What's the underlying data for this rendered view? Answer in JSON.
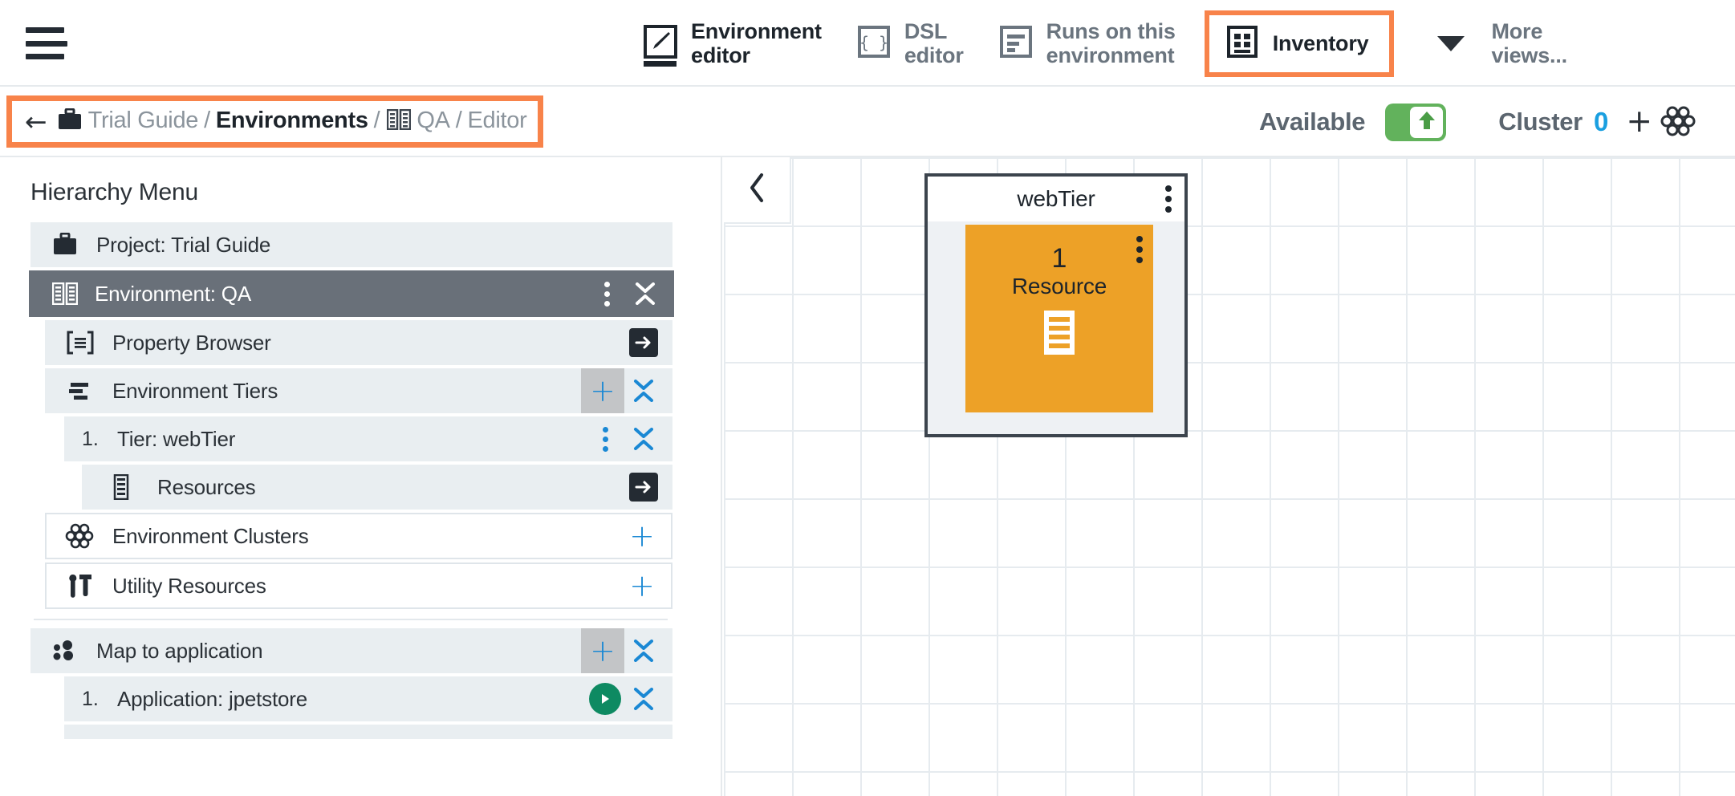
{
  "topbar": {
    "menu_icon": "hamburger-menu-icon",
    "tabs": [
      {
        "label": "Environment\neditor",
        "icon": "environment-editor-icon",
        "active": true,
        "highlighted": false
      },
      {
        "label": "DSL\neditor",
        "icon": "dsl-editor-icon",
        "active": false,
        "highlighted": false
      },
      {
        "label": "Runs on this\nenvironment",
        "icon": "runs-on-environment-icon",
        "active": false,
        "highlighted": false
      },
      {
        "label": "Inventory",
        "icon": "inventory-icon",
        "active": false,
        "highlighted": true
      },
      {
        "label": "More\nviews...",
        "icon": "chevron-down-icon",
        "active": false,
        "highlighted": false
      }
    ]
  },
  "breadcrumb": {
    "back_icon": "back-arrow-icon",
    "project_icon": "briefcase-icon",
    "project": "Trial Guide",
    "sep": "/",
    "section": "Environments",
    "env_icon": "environment-icon",
    "environment": "QA",
    "page": "Editor",
    "highlight_color": "#f8834a"
  },
  "status": {
    "availability_label": "Available",
    "toggle_on": true,
    "toggle_color": "#62b25c",
    "toggle_icon": "arrow-up-icon",
    "cluster_label": "Cluster",
    "cluster_count": "0",
    "cluster_count_color": "#1a9fe0",
    "add_cluster_label": "+",
    "cluster_icon": "cluster-icon"
  },
  "sidebar": {
    "title": "Hierarchy Menu",
    "rows": [
      {
        "level": "lvl0",
        "icon": "briefcase-icon",
        "label": "Project: Trial Guide",
        "num": "",
        "actions": []
      },
      {
        "level": "sel",
        "icon": "environment-icon",
        "label": "Environment: QA",
        "num": "",
        "actions": [
          "kebab-white",
          "collapse-white"
        ]
      },
      {
        "level": "lvl1",
        "icon": "property-browser-icon",
        "label": "Property Browser",
        "num": "",
        "actions": [
          "open-arrow"
        ]
      },
      {
        "level": "lvl1",
        "icon": "tiers-icon",
        "label": "Environment Tiers",
        "num": "",
        "actions": [
          "plus-highlighted",
          "collapse-blue"
        ]
      },
      {
        "level": "lvl2",
        "icon": "",
        "label": "Tier: webTier",
        "num": "1.",
        "actions": [
          "kebab-blue",
          "collapse-blue"
        ]
      },
      {
        "level": "lvl3",
        "icon": "resources-icon",
        "label": "Resources",
        "num": "",
        "actions": [
          "open-arrow"
        ]
      },
      {
        "level": "boxed-white",
        "icon": "cluster-icon",
        "label": "Environment Clusters",
        "num": "",
        "actions": [
          "plus-blue"
        ]
      },
      {
        "level": "boxed-white",
        "icon": "utility-icon",
        "label": "Utility Resources",
        "num": "",
        "actions": [
          "plus-blue"
        ]
      },
      {
        "level": "divider",
        "icon": "",
        "label": "",
        "num": "",
        "actions": []
      },
      {
        "level": "lvl0",
        "icon": "map-application-icon",
        "label": "Map to application",
        "num": "",
        "actions": [
          "plus-highlighted",
          "collapse-blue"
        ]
      },
      {
        "level": "lvl2",
        "icon": "",
        "label": "Application: jpetstore",
        "num": "1.",
        "actions": [
          "play-button",
          "collapse-blue"
        ]
      }
    ]
  },
  "canvas": {
    "collapse_icon": "chevron-left-icon",
    "grid_size": "85",
    "tier_card": {
      "title": "webTier",
      "menu_icon": "kebab-menu-icon",
      "resource_menu_icon": "kebab-menu-icon",
      "count": "1",
      "count_label": "Resource",
      "resource_icon": "resource-document-icon",
      "accent_color": "#eda127",
      "border_color": "#3c444d"
    }
  }
}
